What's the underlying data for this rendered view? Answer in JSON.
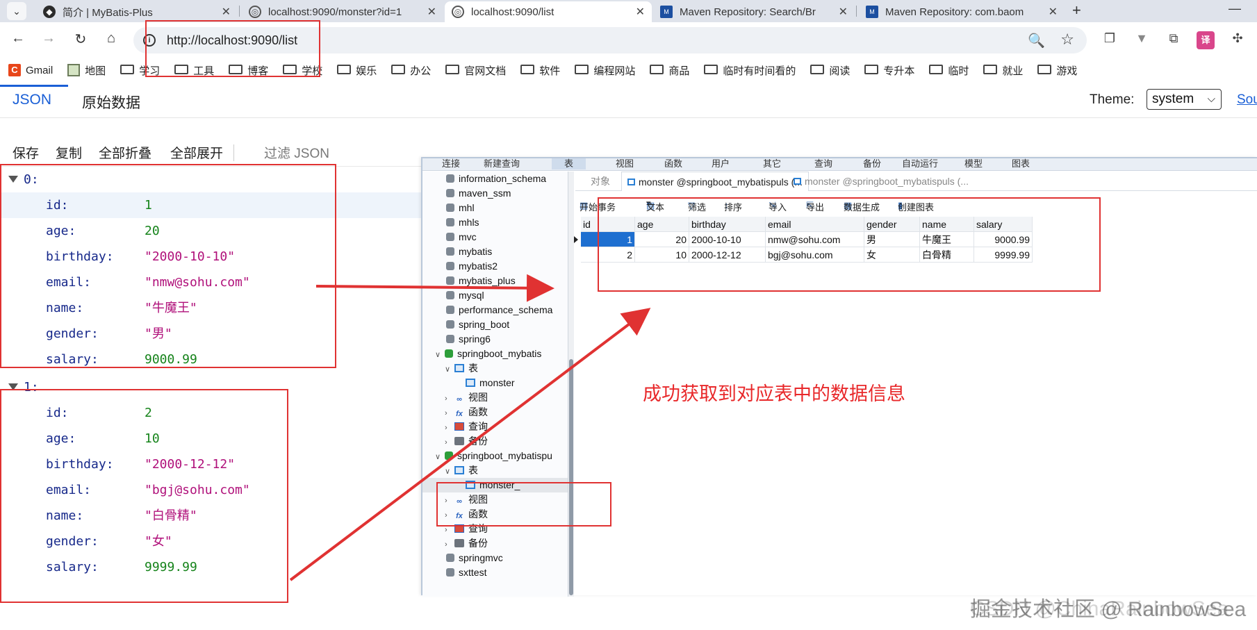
{
  "browser": {
    "tabs": [
      {
        "title": "简介 | MyBatis-Plus",
        "active": false
      },
      {
        "title": "localhost:9090/monster?id=1",
        "active": false
      },
      {
        "title": "localhost:9090/list",
        "active": true
      },
      {
        "title": "Maven Repository: Search/Br",
        "active": false
      },
      {
        "title": "Maven Repository: com.baom",
        "active": false
      }
    ],
    "url": "http://localhost:9090/list",
    "bookmarks": [
      "Gmail",
      "地图",
      "学习",
      "工具",
      "博客",
      "学校",
      "娱乐",
      "办公",
      "官网文档",
      "软件",
      "编程网站",
      "商品",
      "临时有时间看的",
      "阅读",
      "专升本",
      "临时",
      "就业",
      "游戏"
    ]
  },
  "viewer": {
    "tabs": [
      "JSON",
      "原始数据"
    ],
    "theme_label": "Theme:",
    "theme_value": "system",
    "source_link": "Sou",
    "toolbar": [
      "保存",
      "复制",
      "全部折叠",
      "全部展开"
    ],
    "filter_placeholder": "过滤 JSON"
  },
  "json": {
    "records": [
      {
        "index": "0:",
        "fields": [
          {
            "key": "id:",
            "value": "1",
            "kind": "num"
          },
          {
            "key": "age:",
            "value": "20",
            "kind": "num"
          },
          {
            "key": "birthday:",
            "value": "\"2000-10-10\"",
            "kind": "str"
          },
          {
            "key": "email:",
            "value": "\"nmw@sohu.com\"",
            "kind": "str"
          },
          {
            "key": "name:",
            "value": "\"牛魔王\"",
            "kind": "str"
          },
          {
            "key": "gender:",
            "value": "\"男\"",
            "kind": "str"
          },
          {
            "key": "salary:",
            "value": "9000.99",
            "kind": "num"
          }
        ]
      },
      {
        "index": "1:",
        "fields": [
          {
            "key": "id:",
            "value": "2",
            "kind": "num"
          },
          {
            "key": "age:",
            "value": "10",
            "kind": "num"
          },
          {
            "key": "birthday:",
            "value": "\"2000-12-12\"",
            "kind": "str"
          },
          {
            "key": "email:",
            "value": "\"bgj@sohu.com\"",
            "kind": "str"
          },
          {
            "key": "name:",
            "value": "\"白骨精\"",
            "kind": "str"
          },
          {
            "key": "gender:",
            "value": "\"女\"",
            "kind": "str"
          },
          {
            "key": "salary:",
            "value": "9999.99",
            "kind": "num"
          }
        ]
      }
    ]
  },
  "navicat": {
    "ribbon": [
      "连接",
      "新建查询",
      "表",
      "视图",
      "函数",
      "用户",
      "其它",
      "查询",
      "备份",
      "自动运行",
      "模型",
      "图表"
    ],
    "object_tabs": [
      "对象",
      "monster @springboot_mybatispuls (...",
      "monster @springboot_mybatispuls (..."
    ],
    "actions": [
      "开始事务",
      "文本",
      "筛选",
      "排序",
      "导入",
      "导出",
      "数据生成",
      "创建图表"
    ],
    "tree": {
      "databases_top": [
        "information_schema",
        "maven_ssm",
        "mhl",
        "mhls",
        "mvc",
        "mybatis",
        "mybatis2",
        "mybatis_plus",
        "mysql",
        "performance_schema",
        "spring_boot",
        "spring6"
      ],
      "db1": "springboot_mybatis",
      "db1_children": [
        "表",
        "monster",
        "视图",
        "函数",
        "查询",
        "备份"
      ],
      "db2": "springboot_mybatispu",
      "db2_children": [
        "表",
        "monster_",
        "视图",
        "函数",
        "查询",
        "备份"
      ],
      "databases_bottom": [
        "springmvc",
        "sxttest"
      ]
    },
    "grid": {
      "columns": [
        "id",
        "age",
        "birthday",
        "email",
        "gender",
        "name",
        "salary"
      ],
      "rows": [
        [
          "1",
          "20",
          "2000-10-10",
          "nmw@sohu.com",
          "男",
          "牛魔王",
          "9000.99"
        ],
        [
          "2",
          "10",
          "2000-12-12",
          "bgj@sohu.com",
          "女",
          "白骨精",
          "9999.99"
        ]
      ]
    }
  },
  "annotation": {
    "text": "成功获取到对应表中的数据信息",
    "color": "#e8282a"
  },
  "watermark": {
    "text": "掘金技术社区 @ RainbowSea",
    "under_text": "CSDN @ChinaRainbowSea"
  }
}
